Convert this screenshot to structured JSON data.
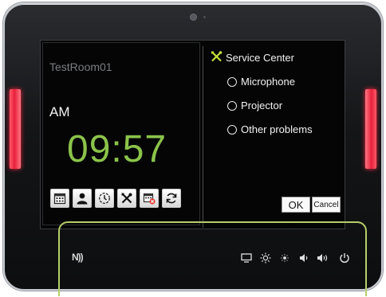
{
  "device": {
    "led_color": "#e8213b",
    "camera": "camera-icon"
  },
  "left_panel": {
    "room_name": "TestRoom01",
    "ampm": "AM",
    "clock": "09:57",
    "clock_color": "#8bc34a",
    "actions": [
      {
        "icon": "calendar-icon"
      },
      {
        "icon": "user-icon"
      },
      {
        "icon": "clock-timer-icon"
      },
      {
        "icon": "tools-icon"
      },
      {
        "icon": "calendar-cancel-icon"
      },
      {
        "icon": "refresh-icon"
      }
    ]
  },
  "service_center": {
    "title": "Service Center",
    "title_icon": "tools-icon",
    "options": [
      "Microphone",
      "Projector",
      "Other problems"
    ],
    "ok_label": "OK",
    "cancel_label": "Cancel"
  },
  "hardware_bar": {
    "icons": [
      "nfc-icon",
      "display-icon",
      "brightness-up-icon",
      "brightness-down-icon",
      "volume-down-icon",
      "volume-up-icon",
      "power-icon"
    ],
    "nfc_glyph": "N))"
  },
  "highlight_color": "#b6cf69"
}
